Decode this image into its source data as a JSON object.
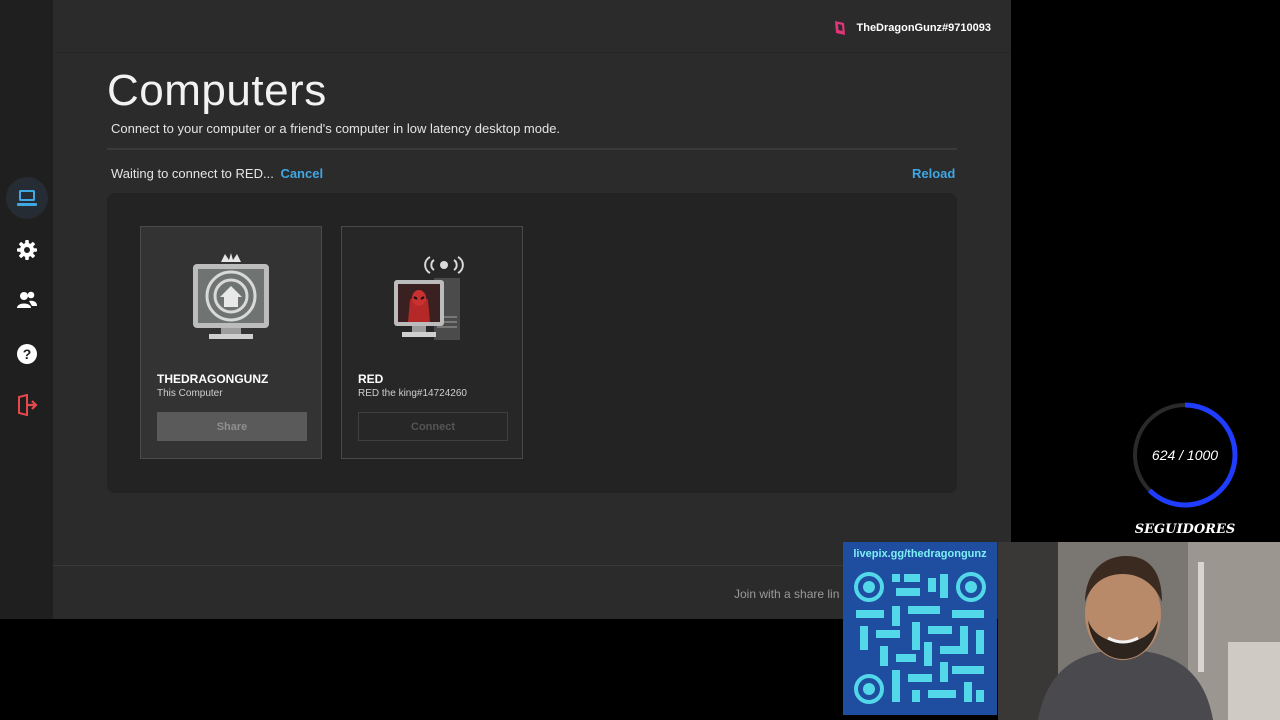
{
  "topbar": {
    "username": "TheDragonGunz#9710093"
  },
  "sidebar": {
    "items": [
      {
        "name": "computers",
        "icon": "laptop-icon"
      },
      {
        "name": "settings",
        "icon": "gear-icon"
      },
      {
        "name": "friends",
        "icon": "users-icon"
      },
      {
        "name": "help",
        "icon": "help-icon"
      },
      {
        "name": "logout",
        "icon": "logout-icon"
      }
    ]
  },
  "page": {
    "title": "Computers",
    "subtitle": "Connect to your computer or a friend's computer in low latency desktop mode.",
    "status_text": "Waiting to connect to RED...",
    "cancel_label": "Cancel",
    "reload_label": "Reload"
  },
  "computers": [
    {
      "name": "THEDRAGONGUNZ",
      "subtitle": "This Computer",
      "button": "Share"
    },
    {
      "name": "RED",
      "subtitle": "RED the king#14724260",
      "button": "Connect"
    }
  ],
  "footer": {
    "join_text": "Join with a share lin"
  },
  "overlay": {
    "follower_count": "624 / 1000",
    "follower_progress": 0.624,
    "follower_label": "SEGUIDORES",
    "donation_url": "livepix.gg/thedragongunz"
  },
  "colors": {
    "accent": "#3fa7e4",
    "logout": "#e5484d",
    "progress": "#1f3cff"
  }
}
